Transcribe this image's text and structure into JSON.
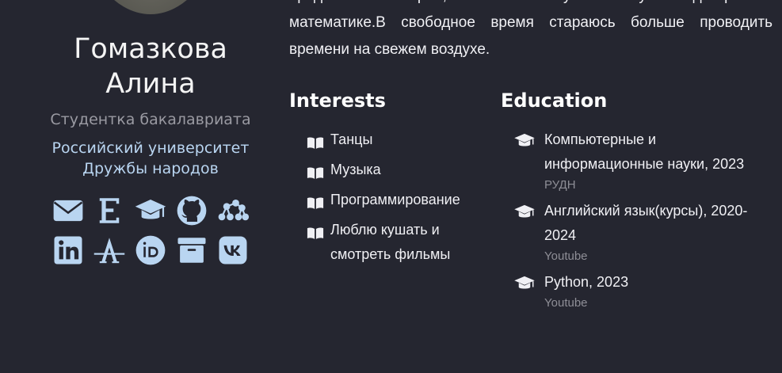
{
  "profile": {
    "name_line1": "Гомазкова",
    "name_line2": "Алина",
    "role": "Студентка бакалавриата",
    "affiliation": "Российский университет Дружбы народов"
  },
  "social_icons": [
    {
      "name": "email-icon"
    },
    {
      "name": "e-letter-icon"
    },
    {
      "name": "graduation-cap-icon"
    },
    {
      "name": "github-icon"
    },
    {
      "name": "researchgate-network-icon"
    },
    {
      "name": "linkedin-icon"
    },
    {
      "name": "academia-a-icon"
    },
    {
      "name": "orcid-icon"
    },
    {
      "name": "archive-box-icon"
    },
    {
      "name": "vk-icon"
    }
  ],
  "about": {
    "text": "предметам.геометрии,математическому анализу и дискретной математике.В свободное время стараюсь больше проводить времени на свежем воздухе."
  },
  "interests": {
    "title": "Interests",
    "items": [
      "Танцы",
      "Музыка",
      "Программирование",
      "Люблю кушать и смотреть фильмы"
    ]
  },
  "education": {
    "title": "Education",
    "items": [
      {
        "degree": "Компьютерные и информационные науки, 2023",
        "institution": "РУДН"
      },
      {
        "degree": "Английский язык(курсы), 2020-2024",
        "institution": "Youtube"
      },
      {
        "degree": "Python, 2023",
        "institution": "Youtube"
      }
    ]
  },
  "colors": {
    "background": "#252630",
    "accent": "#b9d5f1",
    "muted": "#9a9aa2"
  }
}
